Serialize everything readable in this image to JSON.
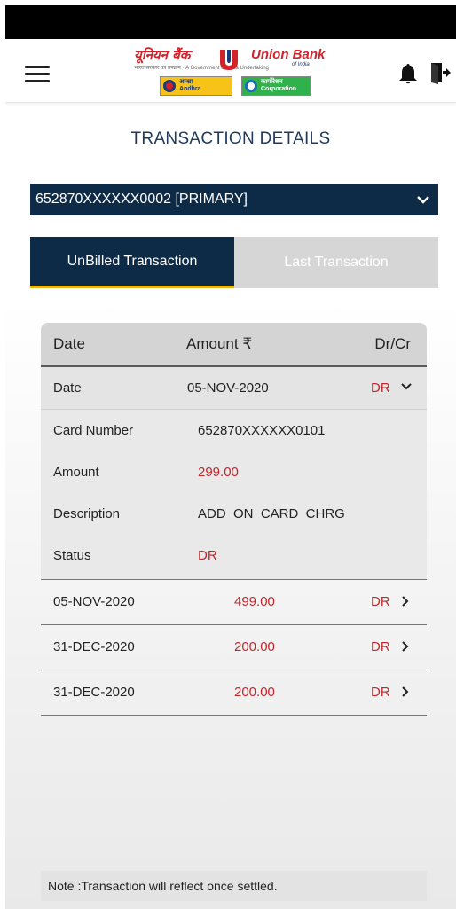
{
  "header": {
    "logo": {
      "hindi_name": "यूनियन बैंक",
      "hindi_sub": "ऑफ़ इंडिया",
      "tagline": "भारत सरकार का उपक्रम · A Government of India Undertaking",
      "english_name": "Union Bank",
      "english_sub": "of India",
      "partner_andhra_hindi": "आन्ध्रा",
      "partner_andhra": "Andhra",
      "partner_corp_hindi": "कार्पोरेशन",
      "partner_corp": "Corporation"
    },
    "icons": [
      "hamburger-menu-icon",
      "bell-icon",
      "logout-icon"
    ]
  },
  "page": {
    "title": "TRANSACTION DETAILS"
  },
  "account_select": {
    "value": "652870XXXXXX0002 [PRIMARY]"
  },
  "tabs": [
    {
      "label": "UnBilled Transaction",
      "active": true
    },
    {
      "label": "Last Transaction",
      "active": false
    }
  ],
  "table": {
    "headers": {
      "date": "Date",
      "amount": "Amount",
      "currency_symbol": "₹",
      "drcr": "Dr/Cr"
    },
    "expanded": {
      "date_label": "Date",
      "date_value": "05-NOV-2020",
      "drcr": "DR",
      "details": [
        {
          "label": "Card Number",
          "value": "652870XXXXXX0101"
        },
        {
          "label": "Amount",
          "value": "299.00"
        },
        {
          "label": "Description",
          "value": "ADD  ON  CARD  CHRG"
        },
        {
          "label": "Status",
          "value": "DR"
        }
      ]
    },
    "rows": [
      {
        "date": "05-NOV-2020",
        "amount": "499.00",
        "drcr": "DR"
      },
      {
        "date": "31-DEC-2020",
        "amount": "200.00",
        "drcr": "DR"
      },
      {
        "date": "31-DEC-2020",
        "amount": "200.00",
        "drcr": "DR"
      }
    ]
  },
  "note": "Note :Transaction will reflect once settled.",
  "colors": {
    "navy": "#0d2b46",
    "accent_gold": "#e9b517",
    "debit_red": "#c0272d",
    "title_blue": "#1f3a5c"
  }
}
